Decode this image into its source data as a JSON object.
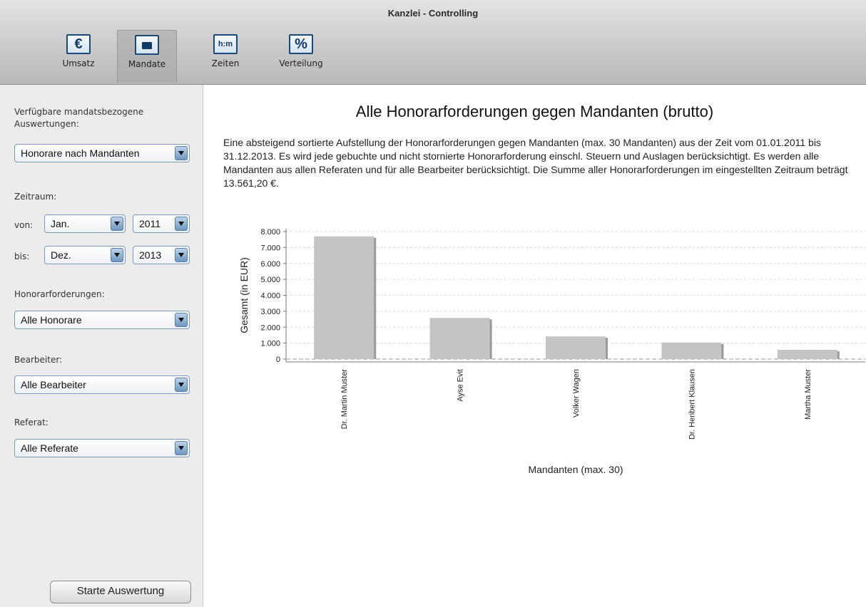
{
  "window": {
    "title": "Kanzlei - Controlling"
  },
  "toolbar": {
    "items": [
      {
        "label": "Umsatz",
        "icon": "euro-icon",
        "glyph": "€"
      },
      {
        "label": "Mandate",
        "icon": "folder-icon",
        "glyph": ""
      },
      {
        "label": "Zeiten",
        "icon": "clock-hm-icon",
        "glyph": "h:m"
      },
      {
        "label": "Verteilung",
        "icon": "percent-icon",
        "glyph": "%"
      }
    ],
    "active": "Mandate"
  },
  "sidebar": {
    "evaluations_label": "Verfügbare mandatsbezogene Auswertungen:",
    "evaluation_value": "Honorare nach Mandanten",
    "period_label": "Zeitraum:",
    "from_label": "von:",
    "from_month": "Jan.",
    "from_year": "2011",
    "to_label": "bis:",
    "to_month": "Dez.",
    "to_year": "2013",
    "fees_label": "Honorarforderungen:",
    "fees_value": "Alle Honorare",
    "staff_label": "Bearbeiter:",
    "staff_value": "Alle Bearbeiter",
    "dept_label": "Referat:",
    "dept_value": "Alle Referate",
    "start_button": "Starte Auswertung"
  },
  "main": {
    "title": "Alle Honorarforderungen gegen Mandanten (brutto)",
    "description": "Eine absteigend sortierte Aufstellung der Honorarforderungen gegen Mandanten (max. 30 Mandanten) aus der Zeit vom 01.01.2011 bis 31.12.2013. Es wird jede gebuchte und nicht stornierte Honorarforderung einschl. Steuern und Auslagen berücksichtigt. Es werden alle Mandanten aus allen Referaten und für alle Bearbeiter berücksichtigt. Die Summe aller Honorarforderungen im eingestellten Zeitraum beträgt 13.561,20 €."
  },
  "chart_data": {
    "type": "bar",
    "categories": [
      "Dr. Martin Muster",
      "Ayse Evit",
      "Volker Wagen",
      "Dr. Heribert Klausen",
      "Martha Muster"
    ],
    "values": [
      7700,
      2580,
      1420,
      1040,
      580
    ],
    "xlabel": "Mandanten (max. 30)",
    "ylabel": "Gesamt (in EUR)",
    "ylim": [
      0,
      8000
    ],
    "yticks": [
      "0",
      "1.000",
      "2.000",
      "3.000",
      "4.000",
      "5.000",
      "6.000",
      "7.000",
      "8.000"
    ],
    "grid": true,
    "bar_color": "#c4c4c4"
  }
}
